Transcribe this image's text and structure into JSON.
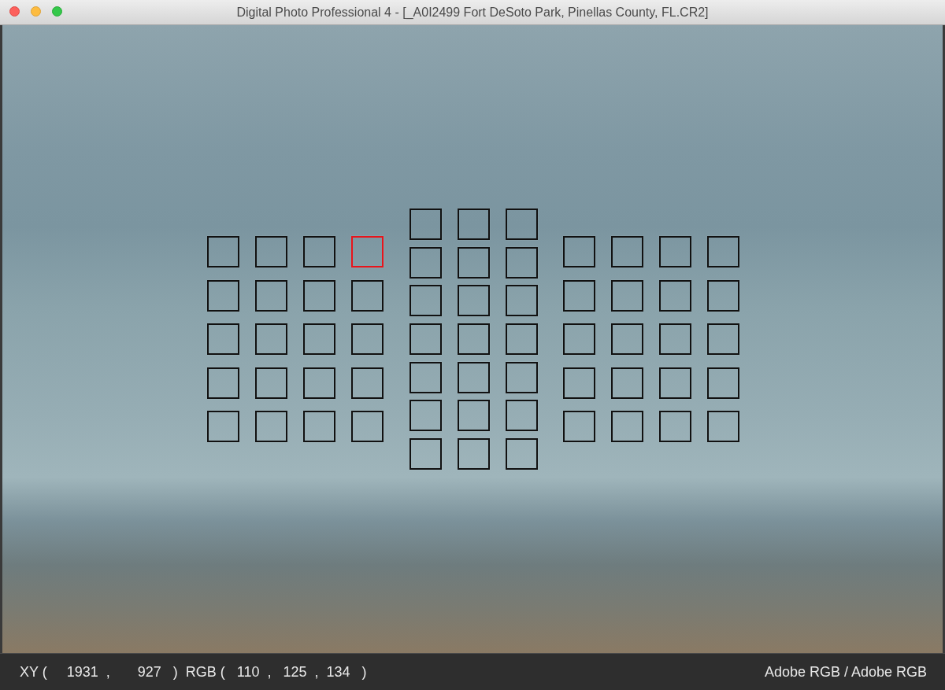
{
  "window": {
    "title": "Digital Photo Professional 4 - [_A0I2499 Fort DeSoto Park, Pinellas County, FL.CR2]"
  },
  "af_points": {
    "groups": [
      {
        "rows": [
          [
            {
              "selected": false
            },
            {
              "selected": false
            },
            {
              "selected": false
            },
            {
              "selected": true
            }
          ],
          [
            {
              "selected": false
            },
            {
              "selected": false
            },
            {
              "selected": false
            },
            {
              "selected": false
            }
          ],
          [
            {
              "selected": false
            },
            {
              "selected": false
            },
            {
              "selected": false
            },
            {
              "selected": false
            }
          ],
          [
            {
              "selected": false
            },
            {
              "selected": false
            },
            {
              "selected": false
            },
            {
              "selected": false
            }
          ],
          [
            {
              "selected": false
            },
            {
              "selected": false
            },
            {
              "selected": false
            },
            {
              "selected": false
            }
          ]
        ]
      },
      {
        "rows": [
          [
            {
              "selected": false
            },
            {
              "selected": false
            },
            {
              "selected": false
            }
          ],
          [
            {
              "selected": false
            },
            {
              "selected": false
            },
            {
              "selected": false
            }
          ],
          [
            {
              "selected": false
            },
            {
              "selected": false
            },
            {
              "selected": false
            }
          ],
          [
            {
              "selected": false
            },
            {
              "selected": false
            },
            {
              "selected": false
            }
          ],
          [
            {
              "selected": false
            },
            {
              "selected": false
            },
            {
              "selected": false
            }
          ],
          [
            {
              "selected": false
            },
            {
              "selected": false
            },
            {
              "selected": false
            }
          ],
          [
            {
              "selected": false
            },
            {
              "selected": false
            },
            {
              "selected": false
            }
          ]
        ]
      },
      {
        "rows": [
          [
            {
              "selected": false
            },
            {
              "selected": false
            },
            {
              "selected": false
            },
            {
              "selected": false
            }
          ],
          [
            {
              "selected": false
            },
            {
              "selected": false
            },
            {
              "selected": false
            },
            {
              "selected": false
            }
          ],
          [
            {
              "selected": false
            },
            {
              "selected": false
            },
            {
              "selected": false
            },
            {
              "selected": false
            }
          ],
          [
            {
              "selected": false
            },
            {
              "selected": false
            },
            {
              "selected": false
            },
            {
              "selected": false
            }
          ],
          [
            {
              "selected": false
            },
            {
              "selected": false
            },
            {
              "selected": false
            },
            {
              "selected": false
            }
          ]
        ]
      }
    ]
  },
  "status_bar": {
    "cursor_position": "XY (     1931  ,       927   )",
    "pixel_rgb": "RGB (   110  ,   125  ,  134   )",
    "color_space": "Adobe RGB / Adobe RGB"
  }
}
